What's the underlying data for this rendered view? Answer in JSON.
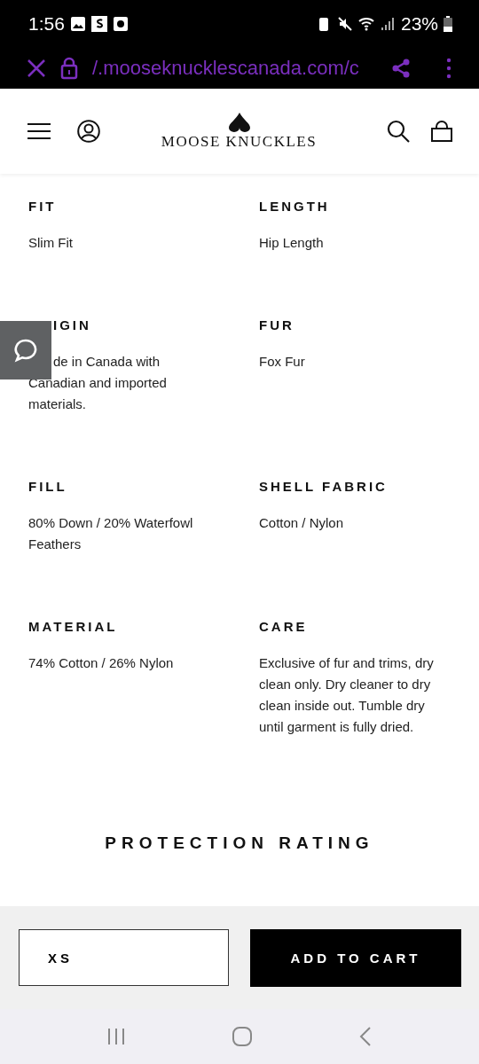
{
  "status_bar": {
    "time": "1:56",
    "battery": "23%"
  },
  "browser": {
    "url": "/.mooseknucklescanada.com/c"
  },
  "header": {
    "logo": "MOOSE KNUCKLES"
  },
  "specs": [
    {
      "label": "FIT",
      "value": "Slim Fit",
      "covered": false
    },
    {
      "label": "LENGTH",
      "value": "Hip Length",
      "covered": false
    },
    {
      "label": "IGIN",
      "value": "de in Canada with Canadian and imported materials.",
      "covered": true
    },
    {
      "label": "FUR",
      "value": "Fox Fur",
      "covered": false
    },
    {
      "label": "FILL",
      "value": "80% Down / 20% Waterfowl Feathers",
      "covered": false
    },
    {
      "label": "SHELL FABRIC",
      "value": "Cotton / Nylon",
      "covered": false
    },
    {
      "label": "MATERIAL",
      "value": "74% Cotton / 26% Nylon",
      "covered": false
    },
    {
      "label": "CARE",
      "value": "Exclusive of fur and trims, dry clean only. Dry cleaner to dry clean inside out. Tumble dry until garment is fully dried.",
      "covered": false
    }
  ],
  "section_title": "PROTECTION RATING",
  "footer": {
    "size": "XS",
    "add_to_cart": "ADD TO CART"
  }
}
